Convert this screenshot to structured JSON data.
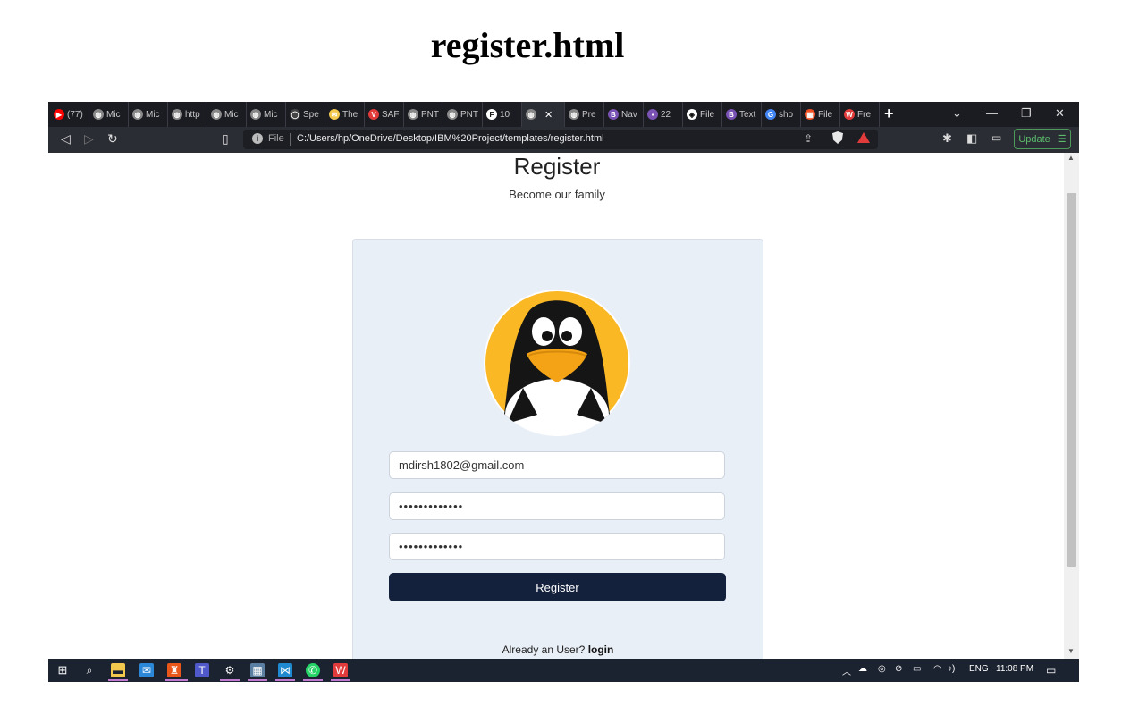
{
  "document": {
    "title": "register.html"
  },
  "browser": {
    "tabs": [
      {
        "label": "(77)",
        "icon": "youtube-icon",
        "color": "#ff0000"
      },
      {
        "label": "Mic",
        "icon": "globe-icon",
        "color": "#888888"
      },
      {
        "label": "Mic",
        "icon": "globe-icon",
        "color": "#888888"
      },
      {
        "label": "http",
        "icon": "globe-icon",
        "color": "#888888"
      },
      {
        "label": "Mic",
        "icon": "globe-icon",
        "color": "#888888"
      },
      {
        "label": "Mic",
        "icon": "globe-icon",
        "color": "#888888"
      },
      {
        "label": "Spe",
        "icon": "github-icon",
        "color": "#444444"
      },
      {
        "label": "The",
        "icon": "mail-icon",
        "color": "#f2c94c"
      },
      {
        "label": "SAF",
        "icon": "vivaldi-icon",
        "color": "#e23b3b"
      },
      {
        "label": "PNT",
        "icon": "globe-icon",
        "color": "#888888"
      },
      {
        "label": "PNT",
        "icon": "globe-icon",
        "color": "#888888"
      },
      {
        "label": "10",
        "icon": "f-icon",
        "color": "#ffffff"
      },
      {
        "label": "",
        "icon": "globe-icon",
        "color": "#888888",
        "active": true
      },
      {
        "label": "Pre",
        "icon": "globe-icon",
        "color": "#888888"
      },
      {
        "label": "Nav",
        "icon": "bootstrap-icon",
        "color": "#7952b3"
      },
      {
        "label": "22",
        "icon": "app-icon",
        "color": "#7952b3"
      },
      {
        "label": "File",
        "icon": "file-icon",
        "color": "#ffffff"
      },
      {
        "label": "Text",
        "icon": "bootstrap-icon",
        "color": "#7952b3"
      },
      {
        "label": "sho",
        "icon": "google-icon",
        "color": "#4285f4"
      },
      {
        "label": "File",
        "icon": "microsoft-icon",
        "color": "#f25022"
      },
      {
        "label": "Fre",
        "icon": "wps-icon",
        "color": "#e23b3b"
      }
    ],
    "address": {
      "scheme_label": "File",
      "url": "C:/Users/hp/OneDrive/Desktop/IBM%20Project/templates/register.html"
    },
    "update_label": "Update"
  },
  "page": {
    "heading": "Register",
    "subtitle": "Become our family",
    "email_value": "mdirsh1802@gmail.com",
    "password_mask": "•••••••••••••",
    "confirm_mask": "•••••••••••••",
    "register_button": "Register",
    "login_prompt": "Already an User?",
    "login_link": "login"
  },
  "taskbar": {
    "language": "ENG",
    "time": "11:08 PM"
  },
  "colors": {
    "card_bg": "#e9eff7",
    "button_bg": "#14213d",
    "avatar_yellow": "#fbb825"
  }
}
